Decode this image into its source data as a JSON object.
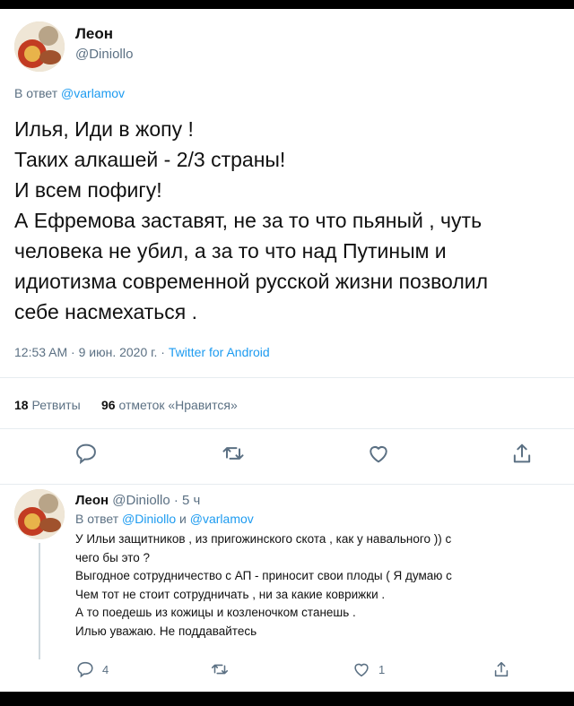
{
  "tweet": {
    "author_name": "Леон",
    "author_handle": "@Diniollo",
    "reply_prefix": "В ответ",
    "reply_to": "@varlamov",
    "lines": [
      "Илья, Иди в жопу !",
      "Таких  алкашей - 2/3 страны!",
      "И всем пофигу!",
      "А Ефремова заставят, не за то что пьяный , чуть",
      "человека не убил,  а за то что над Путиным и",
      "идиотизма современной русской жизни позволил",
      "себе насмехаться ."
    ],
    "timestamp": "12:53 AM · 9 июн. 2020 г. ·",
    "source": "Twitter for Android",
    "retweets_count": "18",
    "retweets_label": "Ретвиты",
    "likes_count": "96",
    "likes_label": "отметок «Нравится»"
  },
  "reply": {
    "author_name": "Леон",
    "author_handle": "@Diniollo",
    "time": "· 5 ч",
    "reply_prefix": "В ответ",
    "reply_to_1": "@Diniollo",
    "reply_and": "и",
    "reply_to_2": "@varlamov",
    "lines": [
      "У Ильи защитников , из пригожинского скота , как у навального )) с",
      "чего бы это ?",
      "Выгодное сотрудничество с АП - приносит свои плоды ( Я  думаю с",
      "Чем тот не стоит сотрудничать  , ни за какие коврижки  .",
      "А то поедешь из кожицы и козленочком станешь .",
      "Илью уважаю. Не поддавайтесь"
    ],
    "reply_count": "4",
    "like_count": "1"
  },
  "icons": {
    "reply": "reply-bubble-icon",
    "retweet": "retweet-icon",
    "like": "heart-icon",
    "share": "share-icon"
  },
  "colors": {
    "link": "#1d9bf0",
    "muted": "#5b7083",
    "divider": "#e6ecf0"
  }
}
